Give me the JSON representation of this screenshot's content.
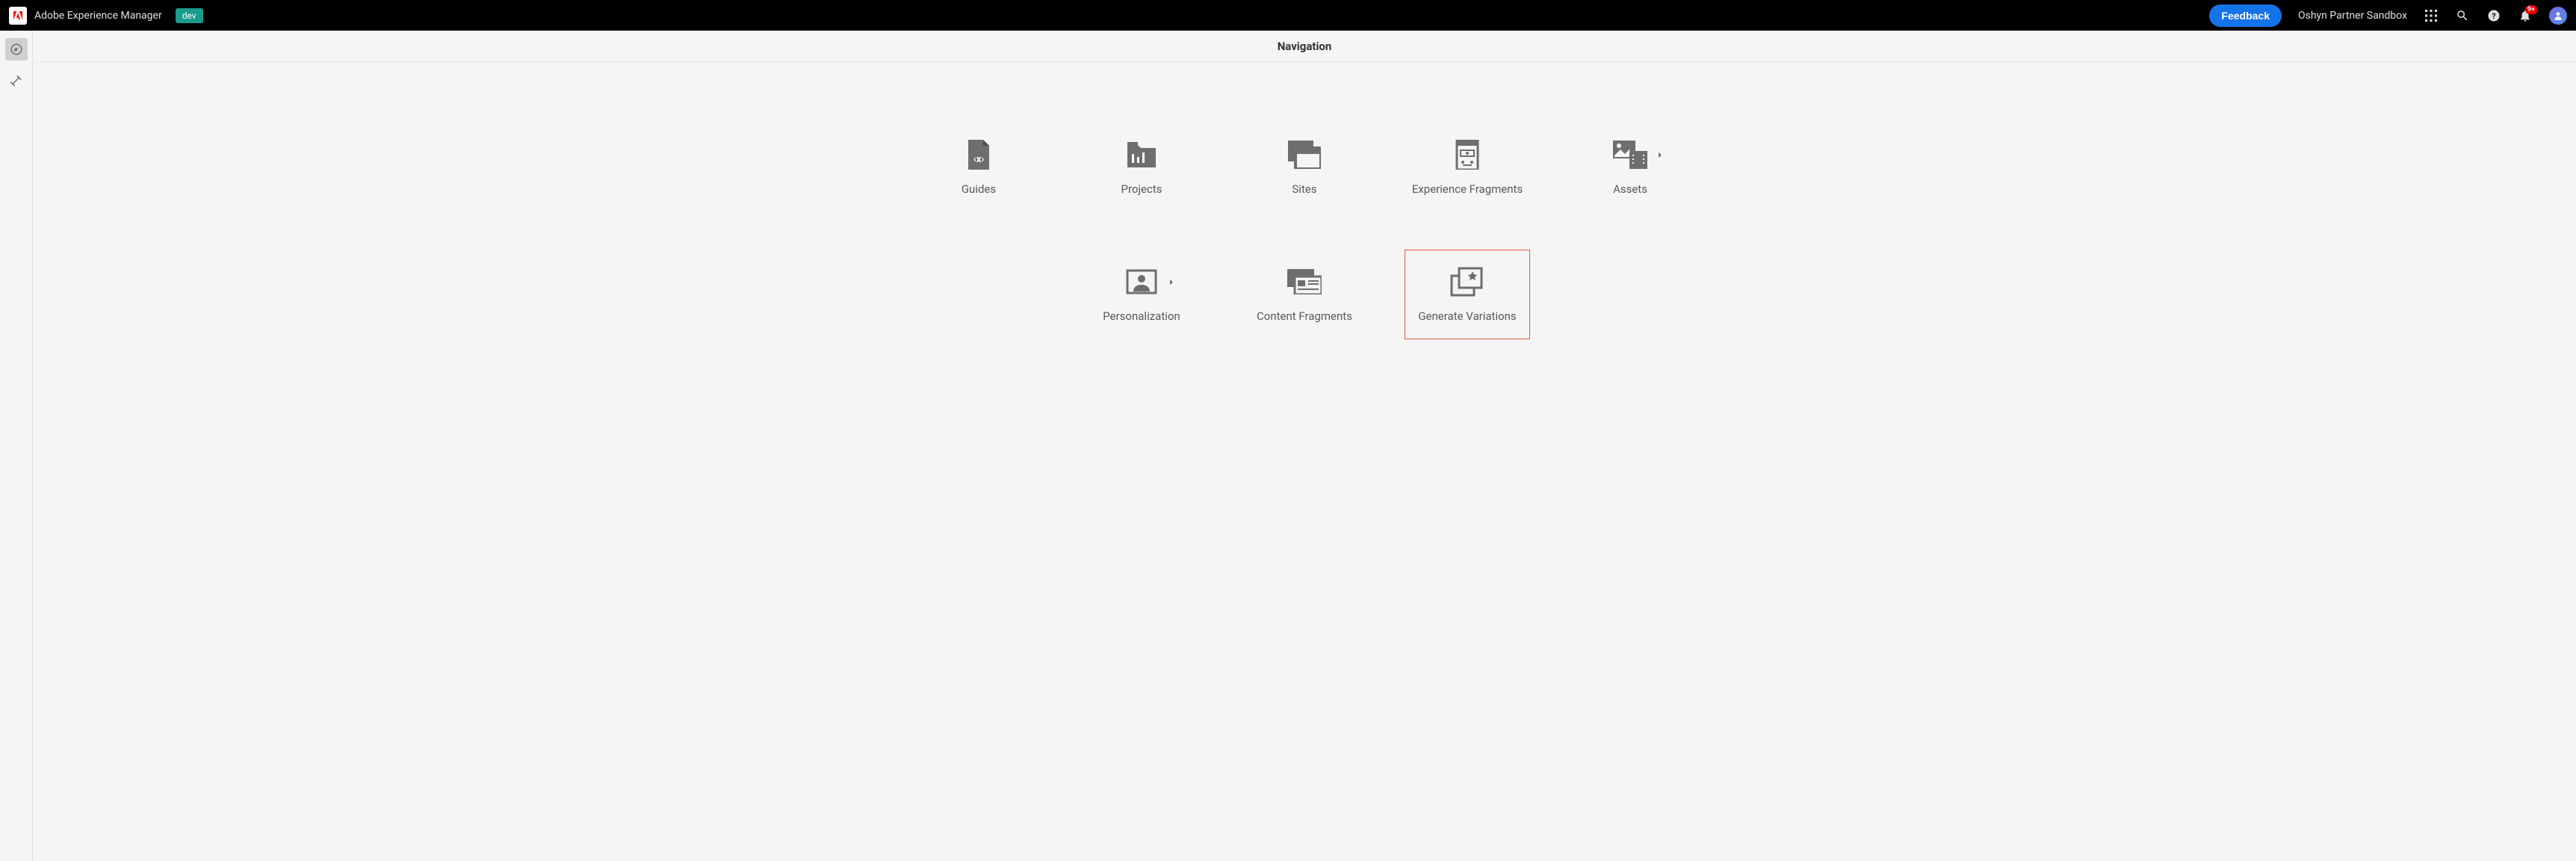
{
  "header": {
    "app_title": "Adobe Experience Manager",
    "env_label": "dev",
    "feedback_label": "Feedback",
    "sandbox_name": "Oshyn Partner Sandbox",
    "notification_badge": "9+"
  },
  "page": {
    "title": "Navigation"
  },
  "tiles": {
    "guides": {
      "label": "Guides",
      "has_chevron": false,
      "highlighted": false
    },
    "projects": {
      "label": "Projects",
      "has_chevron": false,
      "highlighted": false
    },
    "sites": {
      "label": "Sites",
      "has_chevron": false,
      "highlighted": false
    },
    "experience_fragments": {
      "label": "Experience Fragments",
      "has_chevron": false,
      "highlighted": false
    },
    "assets": {
      "label": "Assets",
      "has_chevron": true,
      "highlighted": false
    },
    "personalization": {
      "label": "Personalization",
      "has_chevron": true,
      "highlighted": false
    },
    "content_fragments": {
      "label": "Content Fragments",
      "has_chevron": false,
      "highlighted": false
    },
    "generate_variations": {
      "label": "Generate Variations",
      "has_chevron": false,
      "highlighted": true
    }
  }
}
